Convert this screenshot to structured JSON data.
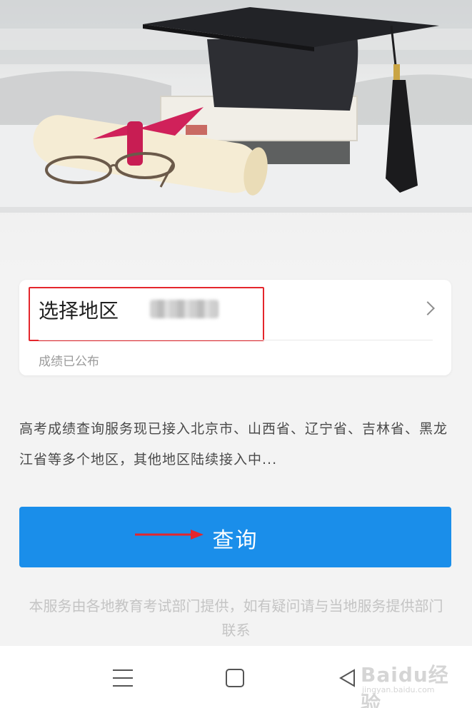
{
  "region_card": {
    "label": "选择地区",
    "status": "成绩已公布"
  },
  "description": "高考成绩查询服务现已接入北京市、山西省、辽宁省、吉林省、黑龙江省等多个地区，其他地区陆续接入中...",
  "query_button": {
    "label": "查询"
  },
  "footer_note": "本服务由各地教育考试部门提供，如有疑问请与当地服务提供部门联系",
  "watermark": {
    "logo": "Baidu经验",
    "url": "jingyan.baidu.com"
  },
  "colors": {
    "primary_button": "#1a8eea",
    "highlight_box": "#e4262c",
    "annotation_arrow": "#e4262c"
  },
  "icons": {
    "chevron": "chevron-right-icon",
    "nav_menu": "menu-icon",
    "nav_home": "home-icon",
    "nav_back": "back-icon",
    "arrow": "annotation-arrow-icon"
  }
}
